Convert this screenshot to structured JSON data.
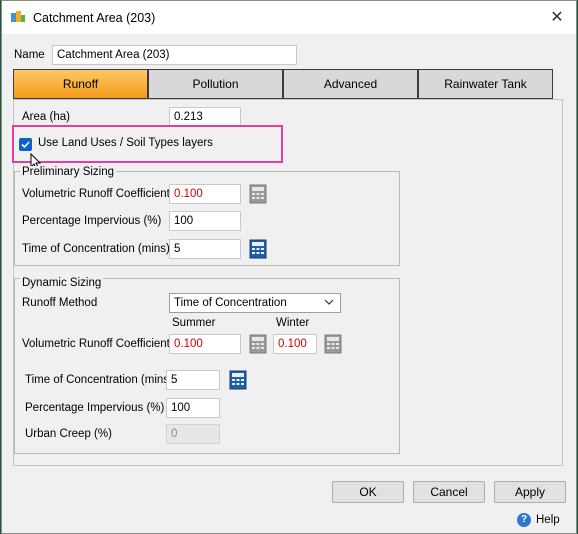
{
  "window": {
    "title": "Catchment Area (203)",
    "close_glyph": "✕"
  },
  "name_field": {
    "label": "Name",
    "value": "Catchment Area (203)"
  },
  "tabs": [
    {
      "label": "Runoff",
      "active": true
    },
    {
      "label": "Pollution",
      "active": false
    },
    {
      "label": "Advanced",
      "active": false
    },
    {
      "label": "Rainwater Tank",
      "active": false
    }
  ],
  "runoff": {
    "area_label": "Area (ha)",
    "area_value": "0.213",
    "use_layers_label": "Use Land Uses / Soil Types layers",
    "use_layers_checked": true,
    "preliminary": {
      "title": "Preliminary Sizing",
      "vrc_label": "Volumetric Runoff Coefficient",
      "vrc_value": "0.100",
      "pi_label": "Percentage Impervious (%)",
      "pi_value": "100",
      "toc_label": "Time of Concentration (mins)",
      "toc_value": "5"
    },
    "dynamic": {
      "title": "Dynamic Sizing",
      "method_label": "Runoff Method",
      "method_value": "Time of Concentration",
      "summer_label": "Summer",
      "winter_label": "Winter",
      "vrc_label": "Volumetric Runoff Coefficient",
      "vrc_summer": "0.100",
      "vrc_winter": "0.100",
      "toc_label": "Time of Concentration (mins)",
      "toc_value": "5",
      "pi_label": "Percentage Impervious (%)",
      "pi_value": "100",
      "urban_creep_label": "Urban Creep (%)",
      "urban_creep_value": "0"
    }
  },
  "buttons": {
    "ok": "OK",
    "cancel": "Cancel",
    "apply": "Apply",
    "help": "Help",
    "help_glyph": "?"
  },
  "colors": {
    "accent_tab": "#f29c18",
    "red_value": "#d00000",
    "highlight": "#e040a0",
    "checkbox": "#0a63c8"
  }
}
